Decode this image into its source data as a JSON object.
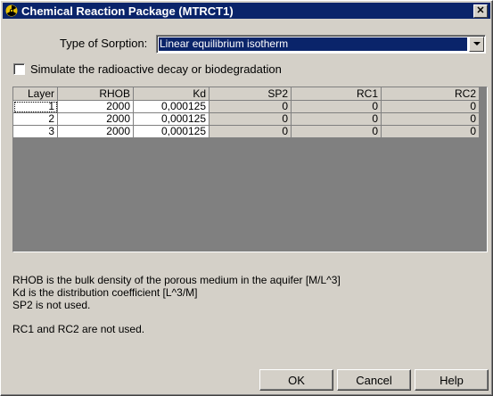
{
  "window": {
    "title": "Chemical Reaction Package (MTRCT1)",
    "icon": "radiation-icon"
  },
  "sorption": {
    "label": "Type of Sorption:",
    "selected": "Linear equilibrium isotherm"
  },
  "decay": {
    "label": "Simulate the radioactive decay or biodegradation",
    "checked": false
  },
  "table": {
    "headers": [
      "Layer",
      "RHOB",
      "Kd",
      "SP2",
      "RC1",
      "RC2"
    ],
    "rows": [
      [
        "1",
        "2000",
        "0,000125",
        "0",
        "0",
        "0"
      ],
      [
        "2",
        "2000",
        "0,000125",
        "0",
        "0",
        "0"
      ],
      [
        "3",
        "2000",
        "0,000125",
        "0",
        "0",
        "0"
      ]
    ]
  },
  "info": {
    "line1": "RHOB is the bulk density of the porous medium in the aquifer [M/L^3]",
    "line2": "Kd is the distribution coefficient [L^3/M]",
    "line3": "SP2 is not used.",
    "line4": "RC1 and RC2 are not used."
  },
  "buttons": {
    "ok": "OK",
    "cancel": "Cancel",
    "help": "Help"
  },
  "colors": {
    "titlebar": "#0a246a",
    "face": "#d4d0c8",
    "selection": "#0a246a",
    "icon": "#e8c000"
  }
}
